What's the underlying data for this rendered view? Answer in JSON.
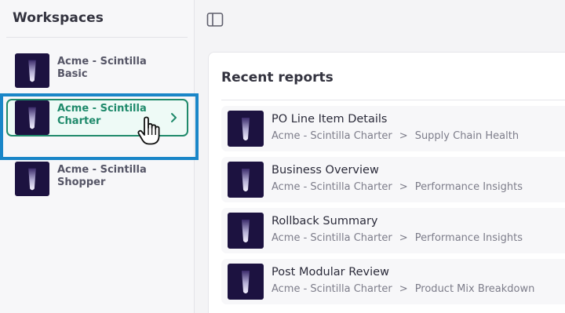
{
  "sidebar": {
    "title": "Workspaces",
    "items": [
      {
        "label_line1": "Acme - Scintilla",
        "label_line2": "Basic",
        "active": false
      },
      {
        "label_line1": "Acme - Scintilla",
        "label_line2": "Charter",
        "active": true
      },
      {
        "label_line1": "Acme - Scintilla",
        "label_line2": "Shopper",
        "active": false
      }
    ]
  },
  "topbar": {
    "toggle_icon": "sidebar-toggle-icon"
  },
  "main": {
    "title": "Recent reports",
    "reports": [
      {
        "name": "PO Line Item Details",
        "workspace": "Acme - Scintilla Charter",
        "separator": ">",
        "section": "Supply Chain Health"
      },
      {
        "name": "Business Overview",
        "workspace": "Acme - Scintilla Charter",
        "separator": ">",
        "section": "Performance Insights"
      },
      {
        "name": "Rollback Summary",
        "workspace": "Acme - Scintilla Charter",
        "separator": ">",
        "section": "Performance Insights"
      },
      {
        "name": "Post Modular Review",
        "workspace": "Acme - Scintilla Charter",
        "separator": ">",
        "section": "Product Mix Breakdown"
      }
    ]
  },
  "colors": {
    "accent": "#1f8a6b",
    "focus_ring": "#1a86c8",
    "thumbnail": "#1c1240"
  }
}
